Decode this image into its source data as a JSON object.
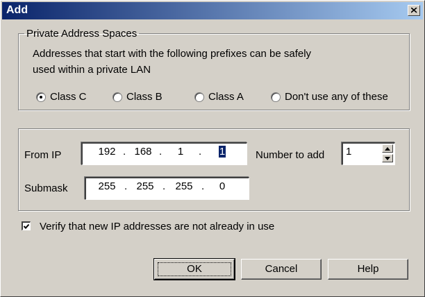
{
  "window": {
    "title": "Add"
  },
  "private_spaces": {
    "legend": "Private Address Spaces",
    "description_line1": "Addresses that start with the following prefixes can be safely",
    "description_line2": "used within a private LAN",
    "options": [
      {
        "label": "Class C",
        "selected": true
      },
      {
        "label": "Class B",
        "selected": false
      },
      {
        "label": "Class A",
        "selected": false
      },
      {
        "label": "Don't use any of these",
        "selected": false
      }
    ]
  },
  "ip": {
    "from_label": "From IP",
    "from_octets": [
      "192",
      "168",
      "1",
      "1"
    ],
    "submask_label": "Submask",
    "submask_octets": [
      "255",
      "255",
      "255",
      "0"
    ],
    "number_label": "Number to add",
    "number_value": "1"
  },
  "verify": {
    "label": "Verify that new IP addresses are not already in use",
    "checked": true
  },
  "buttons": {
    "ok": "OK",
    "cancel": "Cancel",
    "help": "Help"
  },
  "icons": {
    "close": "close-icon",
    "spin_up": "spin-up-icon",
    "spin_down": "spin-down-icon",
    "check": "check-icon"
  }
}
